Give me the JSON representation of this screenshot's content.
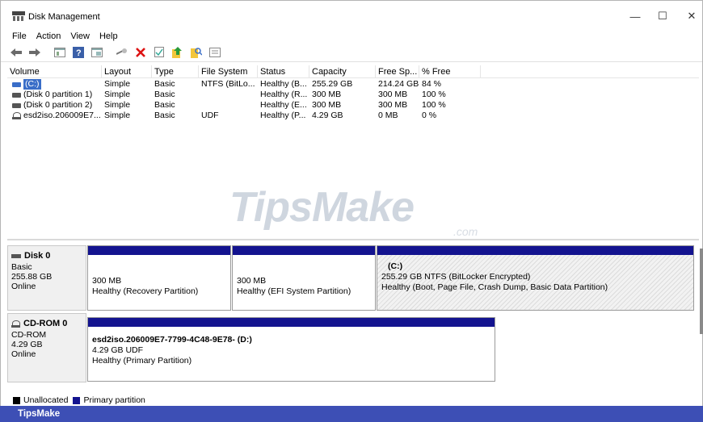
{
  "window": {
    "title": "Disk Management",
    "controls": {
      "minimize": "—",
      "maximize": "☐",
      "close": "✕"
    }
  },
  "menu": [
    "File",
    "Action",
    "View",
    "Help"
  ],
  "toolbar": {
    "icons": [
      "back-arrow-icon",
      "forward-arrow-icon",
      "console-tree-icon",
      "help-icon",
      "properties-icon",
      "connect-icon",
      "delete-icon",
      "check-icon",
      "export-icon",
      "search-icon",
      "list-icon"
    ]
  },
  "volume_table": {
    "columns": [
      "Volume",
      "Layout",
      "Type",
      "File System",
      "Status",
      "Capacity",
      "Free Sp...",
      "% Free"
    ],
    "rows": [
      {
        "volume": "(C:)",
        "layout": "Simple",
        "type": "Basic",
        "fs": "NTFS (BitLo...",
        "status": "Healthy (B...",
        "capacity": "255.29 GB",
        "free": "214.24 GB",
        "pct": "84 %"
      },
      {
        "volume": "(Disk 0 partition 1)",
        "layout": "Simple",
        "type": "Basic",
        "fs": "",
        "status": "Healthy (R...",
        "capacity": "300 MB",
        "free": "300 MB",
        "pct": "100 %"
      },
      {
        "volume": "(Disk 0 partition 2)",
        "layout": "Simple",
        "type": "Basic",
        "fs": "",
        "status": "Healthy (E...",
        "capacity": "300 MB",
        "free": "300 MB",
        "pct": "100 %"
      },
      {
        "volume": "esd2iso.206009E7...",
        "layout": "Simple",
        "type": "Basic",
        "fs": "UDF",
        "status": "Healthy (P...",
        "capacity": "4.29 GB",
        "free": "0 MB",
        "pct": "0 %"
      }
    ]
  },
  "watermark": {
    "main": "TipsMake",
    "sub": ".com"
  },
  "disks": [
    {
      "name": "Disk 0",
      "type": "Basic",
      "size": "255.88 GB",
      "state": "Online",
      "partitions": [
        {
          "title": "",
          "size": "300 MB",
          "status": "Healthy (Recovery Partition)"
        },
        {
          "title": "",
          "size": "300 MB",
          "status": "Healthy (EFI System Partition)"
        },
        {
          "title": "(C:)",
          "size": "255.29 GB NTFS (BitLocker Encrypted)",
          "status": "Healthy (Boot, Page File, Crash Dump, Basic Data Partition)"
        }
      ]
    },
    {
      "name": "CD-ROM 0",
      "type": "CD-ROM",
      "size": "4.29 GB",
      "state": "Online",
      "partitions": [
        {
          "title": "esd2iso.206009E7-7799-4C48-9E78-  (D:)",
          "size": "4.29 GB UDF",
          "status": "Healthy (Primary Partition)"
        }
      ]
    }
  ],
  "legend": [
    {
      "label": "Unallocated",
      "color": "#000000"
    },
    {
      "label": "Primary partition",
      "color": "#13138f"
    }
  ],
  "brand": "TipsMake",
  "colors": {
    "primary_partition": "#13138f",
    "selection": "#3a6ec8",
    "brand_bar": "#3d4fb5"
  }
}
